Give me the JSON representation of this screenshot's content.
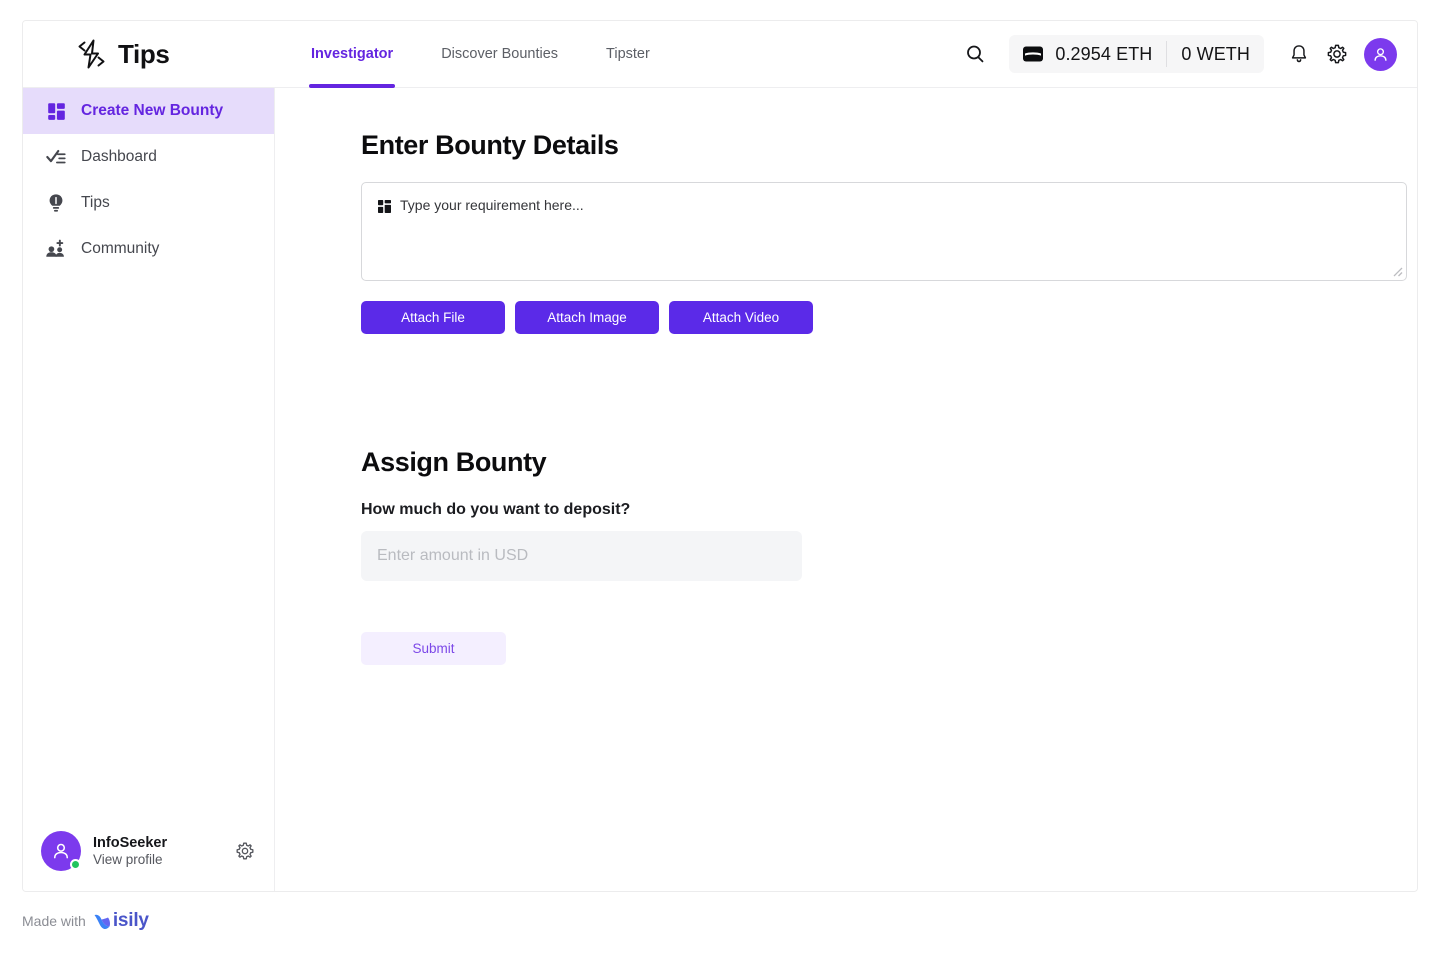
{
  "brand": {
    "name": "Tips",
    "logo_icon": "lightning-bolt-icon"
  },
  "header": {
    "tabs": [
      {
        "label": "Investigator",
        "active": true
      },
      {
        "label": "Discover Bounties",
        "active": false
      },
      {
        "label": "Tipster",
        "active": false
      }
    ],
    "search_icon": "search-icon",
    "wallet": {
      "icon": "wallet-icon",
      "eth_balance": "0.2954 ETH",
      "weth_balance": "0 WETH"
    },
    "notifications_icon": "bell-icon",
    "settings_icon": "gear-icon",
    "avatar_icon": "user-avatar-icon"
  },
  "sidebar": {
    "items": [
      {
        "label": "Create New Bounty",
        "icon": "dashboard-grid-icon",
        "active": true
      },
      {
        "label": "Dashboard",
        "icon": "checklist-icon",
        "active": false
      },
      {
        "label": "Tips",
        "icon": "lightbulb-icon",
        "active": false
      },
      {
        "label": "Community",
        "icon": "group-add-icon",
        "active": false
      }
    ],
    "profile": {
      "name": "InfoSeeker",
      "link": "View profile",
      "avatar_icon": "user-avatar-icon",
      "status": "online",
      "settings_icon": "gear-icon"
    }
  },
  "main": {
    "details_heading": "Enter Bounty Details",
    "requirement_placeholder": "Type your requirement here...",
    "requirement_value": "",
    "requirement_icon": "grid-icon",
    "attach_buttons": [
      {
        "label": "Attach File"
      },
      {
        "label": "Attach Image"
      },
      {
        "label": "Attach Video"
      }
    ],
    "assign_heading": "Assign Bounty",
    "deposit_question": "How much do you want to deposit?",
    "amount_placeholder": "Enter amount in USD",
    "amount_value": "",
    "submit_label": "Submit"
  },
  "watermark": {
    "prefix": "Made with",
    "brand": "isily"
  },
  "colors": {
    "accent": "#6425e0",
    "button_purple": "#5b2ae8",
    "sidebar_active_bg": "#e6dcfb",
    "submit_bg": "#f4efff",
    "submit_text": "#7c48e8",
    "online": "#22c55e",
    "avatar": "#7c3aed"
  }
}
